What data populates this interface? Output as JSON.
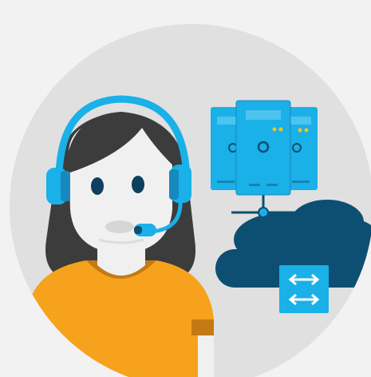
{
  "illustration": {
    "icons": [
      "support-agent-icon",
      "headset-icon",
      "server-rack-icon",
      "network-connection-icon",
      "cloud-icon",
      "data-transfer-icon"
    ]
  },
  "colors": {
    "background": "#f2f2f2",
    "circle": "#e0e0e0",
    "skin": "#f0f0f0",
    "hair": "#3c3c3c",
    "headset": "#1c9fd9",
    "headset_dark": "#1789bd",
    "server_blue": "#1ab0e8",
    "cloud_navy": "#0d4f72",
    "shirt_orange": "#f7a21c",
    "shirt_dark": "#c47a14"
  }
}
